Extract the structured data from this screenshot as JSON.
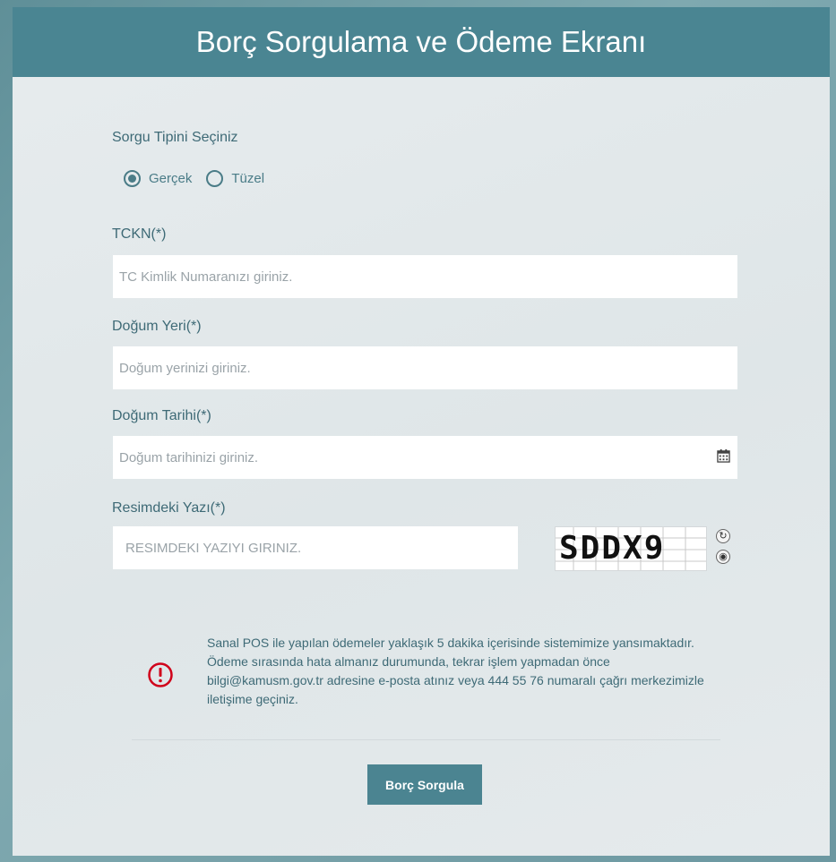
{
  "header": {
    "title": "Borç Sorgulama ve Ödeme Ekranı"
  },
  "query_type": {
    "label": "Sorgu Tipini Seçiniz",
    "options": [
      {
        "label": "Gerçek",
        "selected": true
      },
      {
        "label": "Tüzel",
        "selected": false
      }
    ]
  },
  "tckn": {
    "label": "TCKN(*)",
    "placeholder": "TC Kimlik Numaranızı giriniz."
  },
  "birth_place": {
    "label": "Doğum Yeri(*)",
    "placeholder": "Doğum yerinizi giriniz."
  },
  "birth_date": {
    "label": "Doğum Tarihi(*)",
    "placeholder": "Doğum tarihinizi giriniz.",
    "icon": "calendar-icon"
  },
  "captcha": {
    "label": "Resimdeki Yazı(*)",
    "placeholder": "RESIMDEKI YAZIYI GIRINIZ.",
    "image_text": "SDDX9",
    "refresh_icon": "refresh-icon",
    "audio_icon": "audio-icon"
  },
  "notice": {
    "icon": "warning-icon",
    "color": "#d0021b",
    "text": "Sanal POS ile yapılan ödemeler yaklaşık 5 dakika içerisinde sistemimize yansımaktadır. Ödeme sırasında hata almanız durumunda, tekrar işlem yapmadan önce bilgi@kamusm.gov.tr adresine e-posta atınız veya 444 55 76 numaralı çağrı merkezimizle iletişime geçiniz."
  },
  "submit": {
    "label": "Borç Sorgula"
  },
  "colors": {
    "accent": "#4a8592",
    "label": "#3e6a76",
    "panel": "#e3e9eb"
  }
}
